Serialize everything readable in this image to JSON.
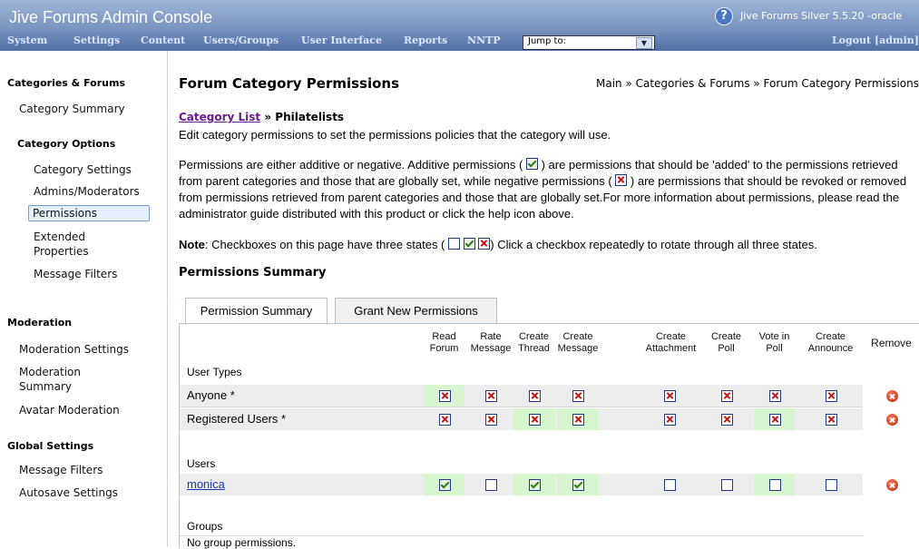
{
  "header": {
    "app_title": "Jive Forums Admin Console",
    "version": "Jive Forums Silver 5.5.20 -oracle",
    "help_icon": "question-circle-icon",
    "nav": [
      "System",
      "Settings",
      "Content",
      "Users/Groups",
      "User Interface",
      "Reports",
      "NNTP"
    ],
    "jump_label": "Jump to:",
    "logout": "Logout [admin]"
  },
  "sidebar": {
    "heading_categories": "Categories & Forums",
    "category_summary": "Category Summary",
    "heading_category_options": "Category Options",
    "category_settings": "Category Settings",
    "admins_moderators": "Admins/Moderators",
    "permissions": "Permissions",
    "extended_1": "Extended",
    "extended_2": "Properties",
    "message_filters": "Message Filters",
    "heading_moderation": "Moderation",
    "moderation_settings": "Moderation Settings",
    "moderation_summary_1": "Moderation",
    "moderation_summary_2": "Summary",
    "avatar_moderation": "Avatar Moderation",
    "heading_global": "Global Settings",
    "global_message_filters": "Message Filters",
    "autosave_settings": "Autosave Settings"
  },
  "main": {
    "page_title": "Forum Category Permissions",
    "breadcrumb": "Main » Categories & Forums » Forum Category Permissions",
    "category_list_link": "Category List",
    "category_separator": " » ",
    "category_name": "Philatelists",
    "intro": "Edit category permissions to set the permissions policies that the category will use.",
    "para_1": "Permissions are either additive or negative. Additive permissions (",
    "para_2": ") are permissions that should be 'added' to the permissions retrieved from parent categories and those that are globally set, while negative permissions (",
    "para_3": ") are permissions that should be revoked or removed from permissions retrieved from parent categories and those that are globally set.For more information about permissions, please read the administrator guide distributed with this product or click the help icon above.",
    "note_label": "Note",
    "note_1": ": Checkboxes on this page have three states (",
    "note_2": ") Click a checkbox repeatedly to rotate through all three states.",
    "summary_title": "Permissions Summary"
  },
  "tabs": [
    "Permission Summary",
    "Grant New Permissions"
  ],
  "table": {
    "columns": [
      [
        "Read",
        "Forum"
      ],
      [
        "Rate",
        "Message"
      ],
      [
        "Create",
        "Thread"
      ],
      [
        "Create",
        "Message"
      ],
      [
        "Create",
        "Attachment"
      ],
      [
        "Create",
        "Poll"
      ],
      [
        "Vote in",
        "Poll"
      ],
      [
        "Create",
        "Announce"
      ]
    ],
    "remove_header": "Remove",
    "group_user_types": "User Types",
    "group_users": "Users",
    "group_groups": "Groups",
    "no_groups": "No group permissions.",
    "rows": [
      {
        "label": "Anyone *",
        "states": [
          "neg",
          "neg",
          "neg",
          "neg",
          "neg",
          "neg",
          "neg",
          "neg"
        ],
        "green": [
          true,
          false,
          false,
          false,
          false,
          false,
          false,
          false
        ]
      },
      {
        "label": "Registered Users *",
        "states": [
          "neg",
          "neg",
          "neg",
          "neg",
          "neg",
          "neg",
          "neg",
          "neg"
        ],
        "green": [
          false,
          false,
          true,
          true,
          false,
          false,
          true,
          false
        ]
      },
      {
        "label": "monica",
        "states": [
          "add",
          "none",
          "add",
          "add",
          "none",
          "none",
          "none",
          "none"
        ],
        "green": [
          true,
          false,
          true,
          true,
          false,
          false,
          true,
          false
        ]
      }
    ]
  }
}
